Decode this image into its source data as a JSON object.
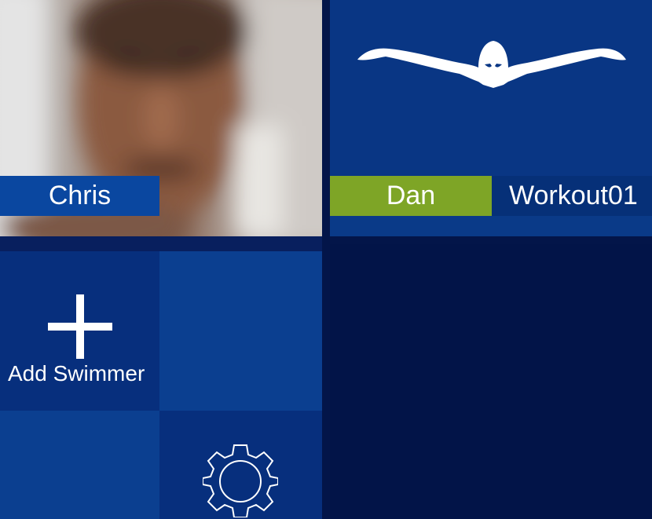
{
  "tiles": {
    "chris": {
      "name": "Chris"
    },
    "dan": {
      "name": "Dan",
      "workout": "Workout01"
    },
    "add_swimmer": {
      "label": "Add Swimmer",
      "icon": "plus-icon"
    },
    "settings": {
      "icon": "gear-icon"
    }
  },
  "colors": {
    "background": "#031549",
    "tile_blue": "#072f7d",
    "tile_light_blue": "#0b3f90",
    "name_bar_blue": "#0a47a0",
    "accent_green": "#7ea526"
  }
}
